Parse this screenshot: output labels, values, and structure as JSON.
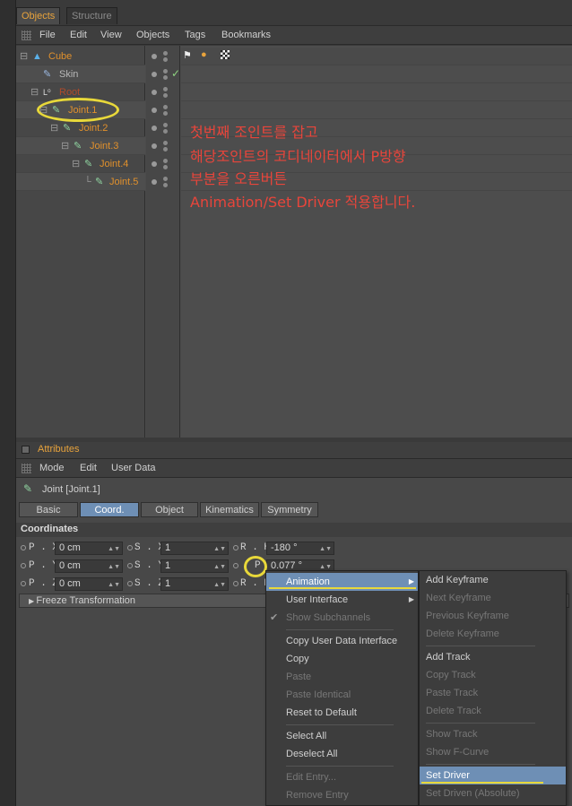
{
  "tabs": [
    {
      "label": "Objects"
    },
    {
      "label": "Structure"
    }
  ],
  "menu": {
    "items": [
      "File",
      "Edit",
      "View",
      "Objects",
      "Tags",
      "Bookmarks"
    ]
  },
  "tree": [
    {
      "label": "Cube"
    },
    {
      "label": "Skin"
    },
    {
      "label": "Root"
    },
    {
      "label": "Joint.1"
    },
    {
      "label": "Joint.2"
    },
    {
      "label": "Joint.3"
    },
    {
      "label": "Joint.4"
    },
    {
      "label": "Joint.5"
    }
  ],
  "annotation": {
    "lines": [
      "첫번째 조인트를 잡고",
      "해당조인트의 코디네이터에서 P방향",
      "부분을 오른버튼",
      "Animation/Set Driver 적용합니다."
    ],
    "color": "#e8453b"
  },
  "attributes": {
    "title": "Attributes",
    "menu": [
      "Mode",
      "Edit",
      "User Data"
    ],
    "object_label": "Joint [Joint.1]",
    "tabs": [
      "Basic",
      "Coord.",
      "Object",
      "Kinematics",
      "Symmetry"
    ],
    "active_tab": "Coord.",
    "section": "Coordinates",
    "fields": {
      "px": {
        "label": "P . X",
        "value": "0 cm"
      },
      "py": {
        "label": "P . Y",
        "value": "0 cm"
      },
      "pz": {
        "label": "P . Z",
        "value": "0 cm"
      },
      "sx": {
        "label": "S . X",
        "value": "1"
      },
      "sy": {
        "label": "S . Y",
        "value": "1"
      },
      "sz": {
        "label": "S . Z",
        "value": "1"
      },
      "rh": {
        "label": "R . H",
        "value": "-180 °"
      },
      "rp": {
        "label": "P",
        "value": "0.077 °"
      },
      "rb": {
        "label": "R . B"
      }
    },
    "freeze": "Freeze Transformation"
  },
  "context_menu": {
    "items": [
      "Animation",
      "User Interface",
      "Show Subchannels",
      "Copy User Data Interface",
      "Copy",
      "Paste",
      "Paste Identical",
      "Reset to Default",
      "Select All",
      "Deselect All",
      "Edit Entry...",
      "Remove Entry"
    ]
  },
  "submenu": {
    "items": [
      "Add Keyframe",
      "Next Keyframe",
      "Previous Keyframe",
      "Delete Keyframe",
      "Add Track",
      "Copy Track",
      "Paste Track",
      "Delete Track",
      "Show Track",
      "Show F-Curve",
      "Set Driver",
      "Set Driven (Absolute)"
    ]
  },
  "colors": {
    "accent": "#e8a33c",
    "highlight": "#6e8fb5",
    "annotation_circle": "#e8d83a"
  }
}
